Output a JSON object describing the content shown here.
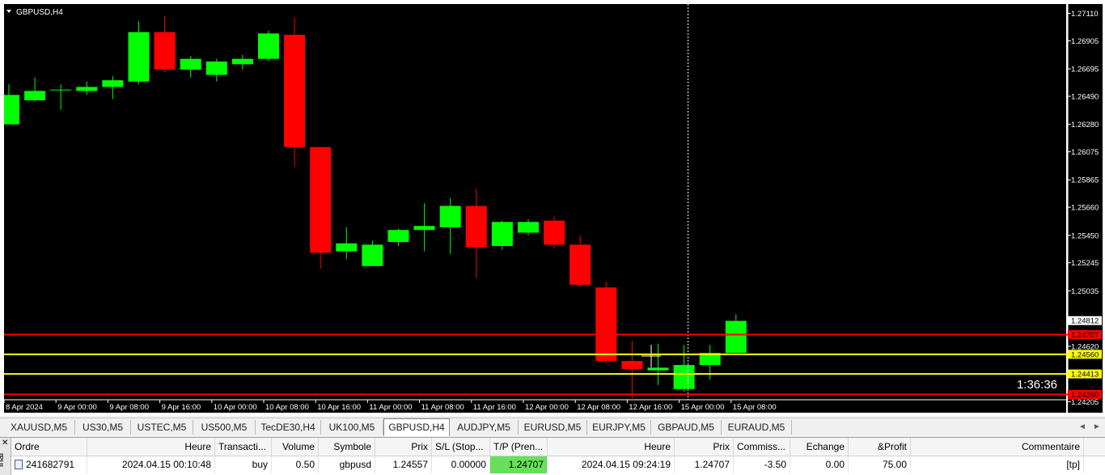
{
  "chart": {
    "title": "GBPUSD,H4",
    "timer": "1:36:36",
    "price_min": 1.2422,
    "price_max": 1.2718,
    "price_ticks": [
      "1.27110",
      "1.26905",
      "1.26695",
      "1.26490",
      "1.26280",
      "1.26075",
      "1.25865",
      "1.25660",
      "1.25450",
      "1.25245",
      "1.25035",
      "1.24620",
      "1.24205"
    ],
    "time_labels": [
      "8 Apr 2024",
      "9 Apr 00:00",
      "9 Apr 08:00",
      "9 Apr 16:00",
      "10 Apr 00:00",
      "10 Apr 08:00",
      "10 Apr 16:00",
      "11 Apr 00:00",
      "11 Apr 08:00",
      "11 Apr 16:00",
      "12 Apr 00:00",
      "12 Apr 08:00",
      "12 Apr 16:00",
      "15 Apr 00:00",
      "15 Apr 08:00"
    ],
    "candles": [
      {
        "o": 1.2628,
        "h": 1.2658,
        "l": 1.2628,
        "c": 1.265
      },
      {
        "o": 1.2646,
        "h": 1.2663,
        "l": 1.2645,
        "c": 1.2653
      },
      {
        "o": 1.2654,
        "h": 1.2658,
        "l": 1.2639,
        "c": 1.2654
      },
      {
        "o": 1.2653,
        "h": 1.266,
        "l": 1.265,
        "c": 1.2656
      },
      {
        "o": 1.2656,
        "h": 1.2664,
        "l": 1.2647,
        "c": 1.2661
      },
      {
        "o": 1.266,
        "h": 1.2705,
        "l": 1.2658,
        "c": 1.2697
      },
      {
        "o": 1.2697,
        "h": 1.2709,
        "l": 1.2667,
        "c": 1.2669
      },
      {
        "o": 1.2669,
        "h": 1.2679,
        "l": 1.2663,
        "c": 1.2677
      },
      {
        "o": 1.2665,
        "h": 1.2677,
        "l": 1.266,
        "c": 1.2675
      },
      {
        "o": 1.2673,
        "h": 1.268,
        "l": 1.2669,
        "c": 1.2677
      },
      {
        "o": 1.2677,
        "h": 1.2698,
        "l": 1.2676,
        "c": 1.2696
      },
      {
        "o": 1.2695,
        "h": 1.2708,
        "l": 1.2596,
        "c": 1.2611
      },
      {
        "o": 1.2611,
        "h": 1.2611,
        "l": 1.252,
        "c": 1.2532
      },
      {
        "o": 1.2533,
        "h": 1.2551,
        "l": 1.2527,
        "c": 1.2539
      },
      {
        "o": 1.2522,
        "h": 1.2541,
        "l": 1.2522,
        "c": 1.2538
      },
      {
        "o": 1.254,
        "h": 1.255,
        "l": 1.2537,
        "c": 1.2549
      },
      {
        "o": 1.2549,
        "h": 1.2569,
        "l": 1.2533,
        "c": 1.2552
      },
      {
        "o": 1.2551,
        "h": 1.2573,
        "l": 1.2531,
        "c": 1.2567
      },
      {
        "o": 1.2567,
        "h": 1.258,
        "l": 1.2513,
        "c": 1.2536
      },
      {
        "o": 1.2537,
        "h": 1.2556,
        "l": 1.2534,
        "c": 1.2555
      },
      {
        "o": 1.2547,
        "h": 1.2557,
        "l": 1.2545,
        "c": 1.2555
      },
      {
        "o": 1.2556,
        "h": 1.2559,
        "l": 1.2535,
        "c": 1.2538
      },
      {
        "o": 1.2538,
        "h": 1.2545,
        "l": 1.2507,
        "c": 1.2508
      },
      {
        "o": 1.2506,
        "h": 1.251,
        "l": 1.2449,
        "c": 1.2451
      },
      {
        "o": 1.2451,
        "h": 1.2466,
        "l": 1.2421,
        "c": 1.2445
      },
      {
        "o": 1.2444,
        "h": 1.2464,
        "l": 1.2433,
        "c": 1.2446
      },
      {
        "o": 1.243,
        "h": 1.2463,
        "l": 1.2428,
        "c": 1.2448
      },
      {
        "o": 1.2448,
        "h": 1.2463,
        "l": 1.2437,
        "c": 1.2457
      },
      {
        "o": 1.2457,
        "h": 1.2486,
        "l": 1.2457,
        "c": 1.2481
      }
    ],
    "levels": [
      {
        "price": 1.24812,
        "label": "1.24812",
        "color": "#ffffff",
        "line": false
      },
      {
        "price": 1.24707,
        "label": "1.24707",
        "color": "#ff0000",
        "line": true
      },
      {
        "price": 1.2456,
        "label": "1.24560",
        "color": "#ffff00",
        "line": true
      },
      {
        "price": 1.24413,
        "label": "1.24413",
        "color": "#ffff00",
        "line": true
      },
      {
        "price": 1.2426,
        "label": "1.24260",
        "color": "#ff0000",
        "line": true
      }
    ],
    "colors": {
      "bg": "#000000",
      "bull": "#00ff00",
      "bear": "#ff0000",
      "wick_bull": "#00ff00",
      "wick_bear": "#ff0000",
      "axis": "#ffffff",
      "text": "#ffffff"
    }
  },
  "tabs": [
    "XAUUSD,M5",
    "US30,M5",
    "USTEC,M5",
    "US500,M5",
    "TecDE30,H4",
    "UK100,M5",
    "GBPUSD,H4",
    "AUDJPY,M5",
    "EURUSD,M5",
    "EURJPY,M5",
    "GBPAUD,M5",
    "EURAUD,M5"
  ],
  "active_tab": "GBPUSD,H4",
  "terminal": {
    "side_label": "inal",
    "columns": [
      "Ordre",
      "Heure",
      "Transacti...",
      "Volume",
      "Symbole",
      "Prix",
      "S/L (Stop...",
      "T/P (Pren...",
      "Heure",
      "Prix",
      "Commiss...",
      "Echange",
      "&Profit",
      "Commentaire"
    ],
    "row": [
      "241682791",
      "2024.04.15 00:10:48",
      "buy",
      "0.50",
      "gbpusd",
      "1.24557",
      "0.00000",
      "1.24707",
      "2024.04.15 09:24:19",
      "1.24707",
      "-3.50",
      "0.00",
      "75.00",
      "[tp]"
    ]
  }
}
